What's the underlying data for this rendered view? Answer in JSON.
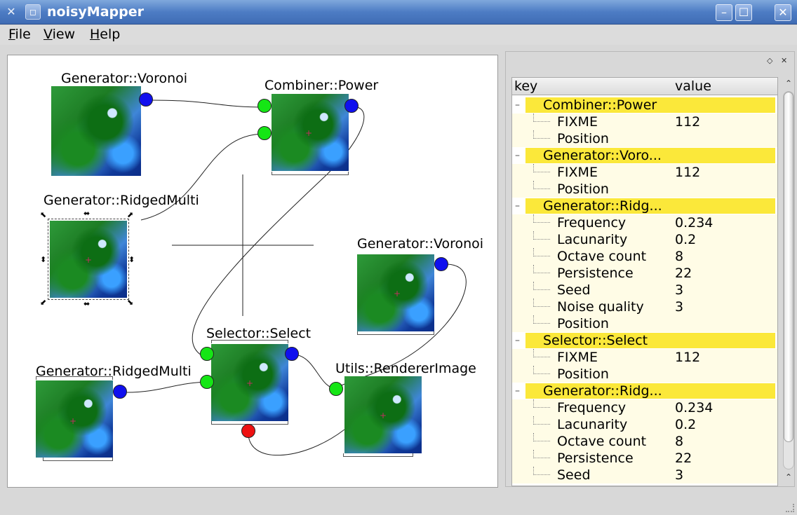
{
  "window": {
    "title": "noisyMapper",
    "icon": "app-icon",
    "controls": {
      "minimize": "–",
      "maximize": "☐",
      "close": "✕"
    }
  },
  "menubar": {
    "items": [
      "File",
      "View",
      "Help"
    ]
  },
  "canvas": {
    "nodes": [
      {
        "id": "n1",
        "title": "Generator::Voronoi"
      },
      {
        "id": "n2",
        "title": "Combiner::Power"
      },
      {
        "id": "n3",
        "title": "Generator::RidgedMulti"
      },
      {
        "id": "n4",
        "title": "Generator::Voronoi"
      },
      {
        "id": "n5",
        "title": "Selector::Select"
      },
      {
        "id": "n6",
        "title": "Generator::RidgedMulti"
      },
      {
        "id": "n7",
        "title": "Utils::RendererImage"
      }
    ],
    "port_colors": {
      "output": "#1010ee",
      "input": "#15e615",
      "control": "#ee1111"
    }
  },
  "properties": {
    "columns": {
      "key": "key",
      "value": "value"
    },
    "groups": [
      {
        "name": "Combiner::Power",
        "rows": [
          {
            "key": "FIXME",
            "value": "112"
          },
          {
            "key": "Position",
            "value": ""
          }
        ]
      },
      {
        "name": "Generator::Voro...",
        "rows": [
          {
            "key": "FIXME",
            "value": "112"
          },
          {
            "key": "Position",
            "value": ""
          }
        ]
      },
      {
        "name": "Generator::Ridg...",
        "rows": [
          {
            "key": "Frequency",
            "value": "0.234"
          },
          {
            "key": "Lacunarity",
            "value": "0.2"
          },
          {
            "key": "Octave count",
            "value": "8"
          },
          {
            "key": "Persistence",
            "value": "22"
          },
          {
            "key": "Seed",
            "value": "3"
          },
          {
            "key": "Noise quality",
            "value": "3"
          },
          {
            "key": "Position",
            "value": ""
          }
        ]
      },
      {
        "name": "Selector::Select",
        "rows": [
          {
            "key": "FIXME",
            "value": "112"
          },
          {
            "key": "Position",
            "value": ""
          }
        ]
      },
      {
        "name": "Generator::Ridg...",
        "rows": [
          {
            "key": "Frequency",
            "value": "0.234"
          },
          {
            "key": "Lacunarity",
            "value": "0.2"
          },
          {
            "key": "Octave count",
            "value": "8"
          },
          {
            "key": "Persistence",
            "value": "22"
          },
          {
            "key": "Seed",
            "value": "3"
          }
        ]
      }
    ],
    "highlight_color": "#fbe83a"
  }
}
